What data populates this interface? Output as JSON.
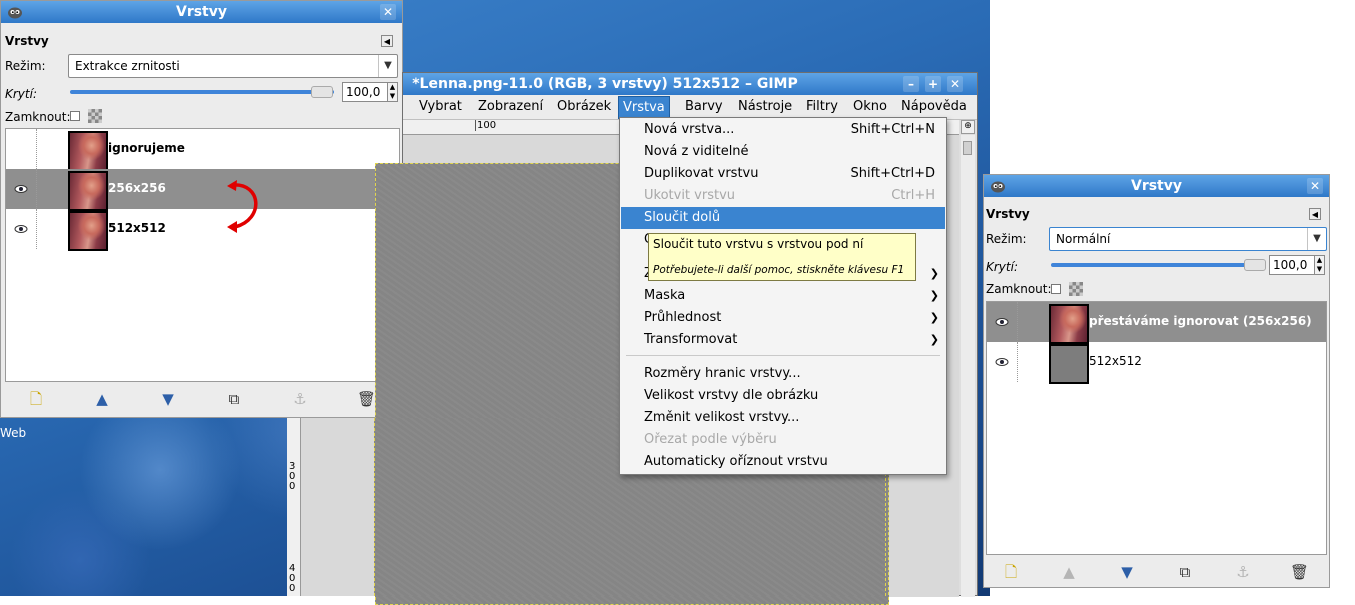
{
  "desktop": {
    "partial_text": "Web"
  },
  "left_dock": {
    "title": "Vrstvy",
    "panel_title": "Vrstvy",
    "mode_label": "Režim:",
    "mode_value": "Extrakce zrnitosti",
    "opacity_label": "Krytí:",
    "opacity_value": "100,0",
    "lock_label": "Zamknout:",
    "layers": [
      {
        "name": "ignorujeme",
        "visible": false,
        "selected": false,
        "thumb": "lenna"
      },
      {
        "name": "256x256",
        "visible": true,
        "selected": true,
        "thumb": "lenna"
      },
      {
        "name": "512x512",
        "visible": true,
        "selected": false,
        "thumb": "lenna"
      }
    ]
  },
  "right_dock": {
    "title": "Vrstvy",
    "panel_title": "Vrstvy",
    "mode_label": "Režim:",
    "mode_value": "Normální",
    "opacity_label": "Krytí:",
    "opacity_value": "100,0",
    "lock_label": "Zamknout:",
    "layers": [
      {
        "name": "přestáváme ignorovat (256x256)",
        "visible": true,
        "selected": true,
        "thumb": "lenna"
      },
      {
        "name": "512x512",
        "visible": true,
        "selected": false,
        "thumb": "gray"
      }
    ]
  },
  "image_window": {
    "title": "*Lenna.png-11.0 (RGB, 3 vrstvy) 512x512 – GIMP",
    "menus": [
      "Vybrat",
      "Zobrazení",
      "Obrázek",
      "Vrstva",
      "Barvy",
      "Nástroje",
      "Filtry",
      "Okno",
      "Nápověda"
    ],
    "active_menu": "Vrstva",
    "ruler_label": "100",
    "vruler_labels": [
      "300",
      "400"
    ]
  },
  "layer_menu": {
    "items": [
      {
        "label": "Nová vrstva...",
        "shortcut": "Shift+Ctrl+N",
        "disabled": false
      },
      {
        "label": "Nová z viditelné",
        "shortcut": "",
        "disabled": false
      },
      {
        "label": "Duplikovat vrstvu",
        "shortcut": "Shift+Ctrl+D",
        "disabled": false
      },
      {
        "label": "Ukotvit vrstvu",
        "shortcut": "Ctrl+H",
        "disabled": true
      },
      {
        "label": "Sloučit dolů",
        "shortcut": "",
        "disabled": false,
        "highlighted": true
      },
      {
        "label": "O",
        "shortcut": "",
        "disabled": false
      },
      {
        "label": "Z",
        "shortcut": "",
        "disabled": false,
        "submenu": true
      },
      {
        "label": "Maska",
        "shortcut": "",
        "disabled": false,
        "submenu": true
      },
      {
        "label": "Průhlednost",
        "shortcut": "",
        "disabled": false,
        "submenu": true
      },
      {
        "label": "Transformovat",
        "shortcut": "",
        "disabled": false,
        "submenu": true
      },
      {
        "label": "Rozměry hranic vrstvy...",
        "shortcut": "",
        "disabled": false
      },
      {
        "label": "Velikost vrstvy dle obrázku",
        "shortcut": "",
        "disabled": false
      },
      {
        "label": "Změnit velikost vrstvy...",
        "shortcut": "",
        "disabled": false
      },
      {
        "label": "Ořezat podle výběru",
        "shortcut": "",
        "disabled": true
      },
      {
        "label": "Automaticky oříznout vrstvu",
        "shortcut": "",
        "disabled": false
      }
    ],
    "tooltip": {
      "main": "Sloučit tuto vrstvu s vrstvou pod ní",
      "hint": "Potřebujete-li další pomoc, stiskněte klávesu F1"
    }
  },
  "colors": {
    "selection": "#3a84d0",
    "annotation_arrow": "#e00000",
    "titlebar": "#2f78c8"
  }
}
